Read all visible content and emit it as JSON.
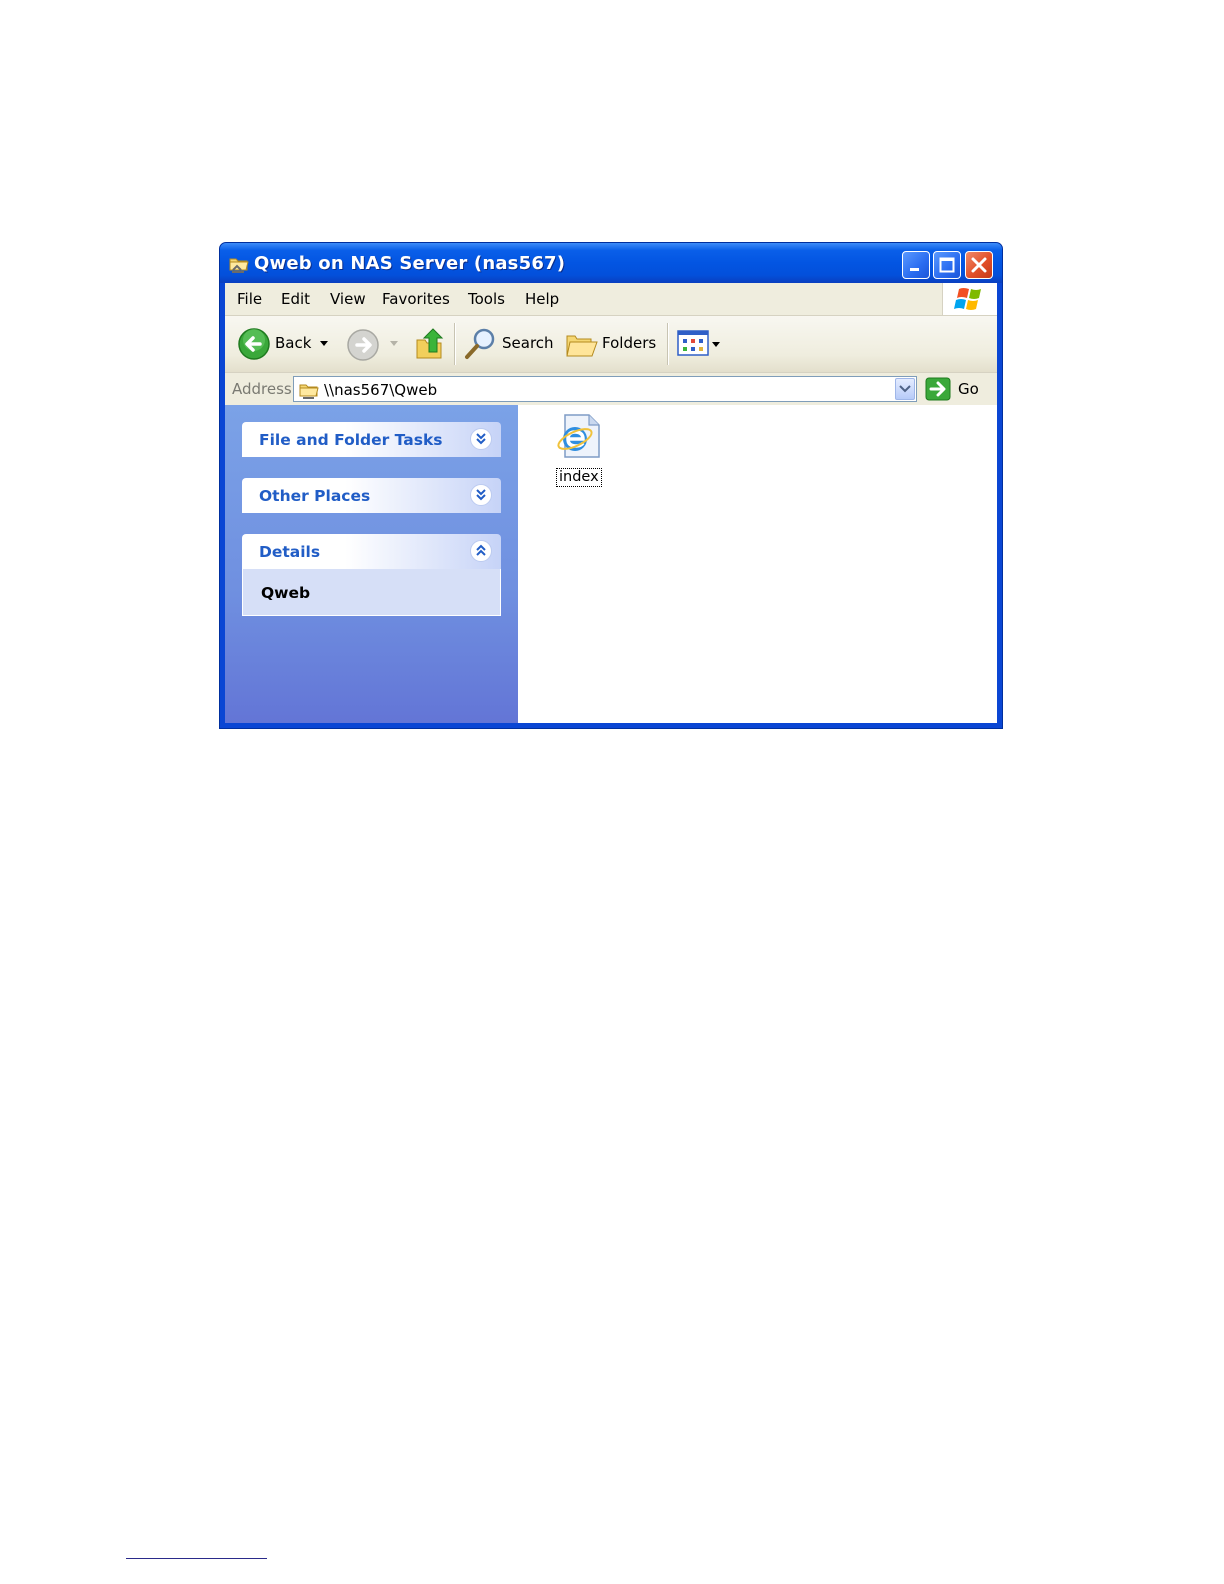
{
  "window": {
    "title": "Qweb on NAS Server (nas567)"
  },
  "menubar": {
    "items": [
      "File",
      "Edit",
      "View",
      "Favorites",
      "Tools",
      "Help"
    ]
  },
  "toolbar": {
    "back_label": "Back",
    "search_label": "Search",
    "folders_label": "Folders"
  },
  "address": {
    "label": "Address",
    "value": "\\\\nas567\\Qweb",
    "go_label": "Go"
  },
  "sidepanel": {
    "sections": [
      {
        "title": "File and Folder Tasks",
        "state": "collapsed"
      },
      {
        "title": "Other Places",
        "state": "collapsed"
      },
      {
        "title": "Details",
        "state": "expanded",
        "content": "Qweb"
      }
    ]
  },
  "files": [
    {
      "name": "index",
      "icon": "internet-explorer-html-icon"
    }
  ],
  "colors": {
    "titlebar": "#0355e2",
    "panel": "#6f8fe0",
    "task_title": "#215dc6"
  }
}
